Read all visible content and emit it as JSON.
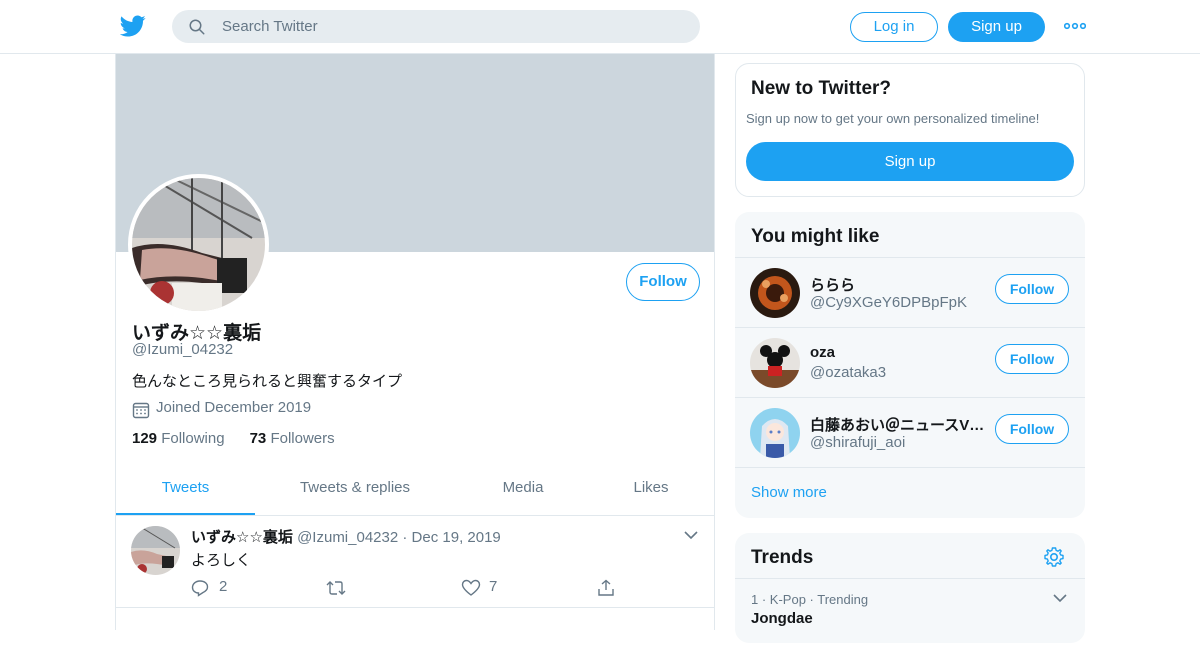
{
  "header": {
    "search_placeholder": "Search Twitter",
    "login_label": "Log in",
    "signup_label": "Sign up"
  },
  "profile": {
    "name": "いずみ☆☆裏垢",
    "handle": "@Izumi_04232",
    "bio": "色んなところ見られると興奮するタイプ",
    "joined": "Joined December 2019",
    "following_count": "129",
    "following_label": "Following",
    "followers_count": "73",
    "followers_label": "Followers",
    "follow_label": "Follow"
  },
  "tabs": [
    {
      "label": "Tweets",
      "active": true
    },
    {
      "label": "Tweets & replies",
      "active": false
    },
    {
      "label": "Media",
      "active": false
    },
    {
      "label": "Likes",
      "active": false
    }
  ],
  "tweet": {
    "name": "いずみ☆☆裏垢",
    "handle": "@Izumi_04232",
    "separator": "·",
    "date": "Dec 19, 2019",
    "text": "よろしく",
    "reply_count": "2",
    "retweet_count": "",
    "like_count": "7"
  },
  "new_to_twitter": {
    "title": "New to Twitter?",
    "subtitle": "Sign up now to get your own personalized timeline!",
    "signup_label": "Sign up"
  },
  "you_might_like": {
    "title": "You might like",
    "users": [
      {
        "name": "ららら",
        "handle": "@Cy9XGeY6DPBpFpK",
        "follow_label": "Follow"
      },
      {
        "name": "oza",
        "handle": "@ozataka3",
        "follow_label": "Follow"
      },
      {
        "name": "白藤あおい＠ニュースVTuber",
        "handle": "@shirafuji_aoi",
        "follow_label": "Follow"
      }
    ],
    "show_more_label": "Show more"
  },
  "trends": {
    "title": "Trends",
    "items": [
      {
        "rank": "1",
        "category": "K-Pop",
        "status": "Trending",
        "name": "Jongdae"
      }
    ]
  },
  "colors": {
    "accent": "#1da1f2",
    "banner": "#ccd6dd",
    "muted_text": "#657786",
    "sidebar_bg": "#f5f8fa"
  },
  "icons": {
    "logo": "twitter-bird-icon",
    "search": "search-icon",
    "more": "more-dots-icon",
    "joined": "calendar-icon",
    "reply": "reply-icon",
    "retweet": "retweet-icon",
    "like": "heart-icon",
    "share": "share-icon",
    "caret": "chevron-down-icon",
    "settings": "gear-icon"
  }
}
